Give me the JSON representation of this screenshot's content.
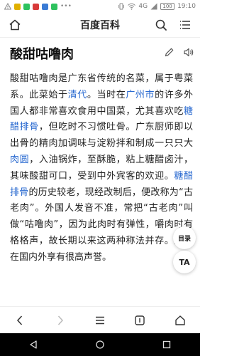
{
  "status_bar": {
    "network": "4G",
    "battery": "100",
    "time": "19:10"
  },
  "header": {
    "title": "百度百科"
  },
  "article": {
    "title": "酸甜咕噜肉",
    "paragraph_parts": [
      {
        "text": "酸甜咕噜肉是广东省传统的名菜，属于粤菜系。此菜始于",
        "link": false
      },
      {
        "text": "清代",
        "link": true
      },
      {
        "text": "。当时在",
        "link": false
      },
      {
        "text": "广州市",
        "link": true
      },
      {
        "text": "的许多外国人都非常喜欢食用中国菜，尤其喜欢吃",
        "link": false
      },
      {
        "text": "糖醋排骨",
        "link": true
      },
      {
        "text": "，但吃时不习惯吐骨。广东厨师即以出骨的精肉加调味与淀粉拌和制成一只只大",
        "link": false
      },
      {
        "text": "肉圆",
        "link": true
      },
      {
        "text": "，入油锅炸，至酥脆，粘上糖醋卤汁，其味酸甜可口，受到中外宾客的欢迎。",
        "link": false
      },
      {
        "text": "糖醋排骨",
        "link": true
      },
      {
        "text": "的历史较老，现经改制后，便改称为“古老肉”。外国人发音不准，常把“古老肉”叫做“咕噜肉”，因为此肉时有弹性，嚼肉时有格格声，故长期以来这两种称法并存。此菜在国内外享有很高声誉。",
        "link": false
      }
    ]
  },
  "floating": {
    "toc_label": "目录",
    "font_label": "TA"
  },
  "colors": {
    "link": "#2a6ad0",
    "text": "#222222",
    "icon": "#333333"
  }
}
